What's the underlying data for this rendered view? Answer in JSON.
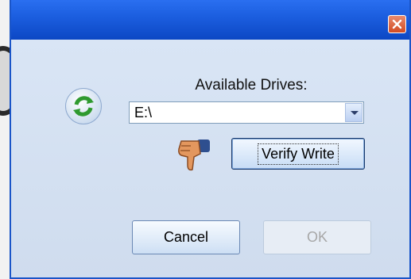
{
  "dialog": {
    "drives_label": "Available Drives:",
    "drive_selected": "E:\\",
    "verify_button": "Verify Write",
    "cancel_button": "Cancel",
    "ok_button": "OK",
    "ok_enabled": false
  },
  "icons": {
    "refresh": "refresh-icon",
    "thumbs_down": "thumbs-down-icon",
    "close": "close-icon",
    "dropdown": "chevron-down-icon"
  },
  "colors": {
    "titlebar": "#1c5fe0",
    "client_bg": "#d9e5f5",
    "close_button": "#d24a22"
  }
}
